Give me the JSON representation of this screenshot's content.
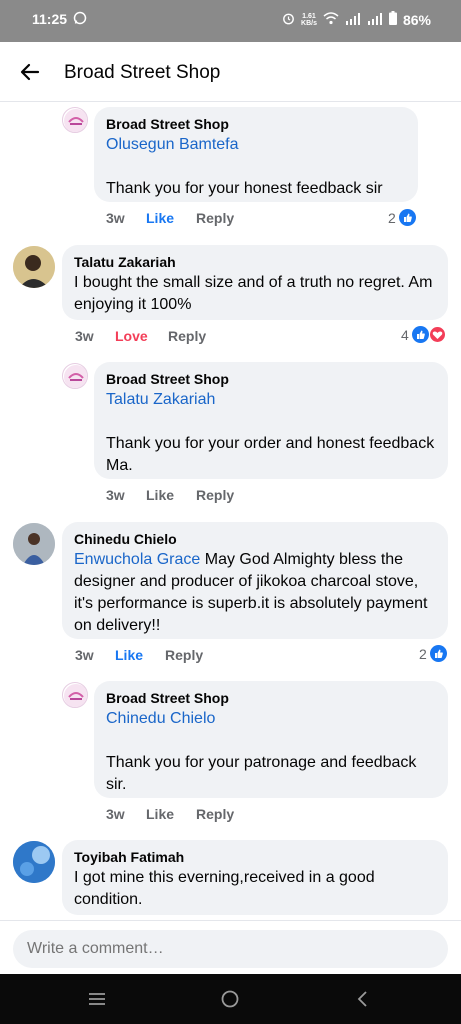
{
  "status_bar": {
    "time": "11:25",
    "speed_value": "1.61",
    "speed_unit": "KB/s",
    "battery": "86%"
  },
  "header": {
    "title": "Broad Street Shop"
  },
  "comments": [
    {
      "author": "Broad Street Shop",
      "mention": "Olusegun Bamtefa",
      "text": "Thank you for your honest feedback sir",
      "time": "3w",
      "like": "Like",
      "reply": "Reply",
      "reactions": "2"
    },
    {
      "author": "Talatu Zakariah",
      "text": "I bought the small size and of a truth no regret. Am enjoying it 100%",
      "time": "3w",
      "like": "Love",
      "reply": "Reply",
      "reactions": "4"
    },
    {
      "author": "Broad Street Shop",
      "mention": "Talatu Zakariah",
      "text": "Thank you for your order and honest feedback Ma.",
      "time": "3w",
      "like": "Like",
      "reply": "Reply"
    },
    {
      "author": "Chinedu Chielo",
      "mention": "Enwuchola Grace",
      "text": " May God Almighty bless the designer and producer of jikokoa charcoal stove, it's performance is superb.it is absolutely payment on delivery!!",
      "time": "3w",
      "like": "Like",
      "reply": "Reply",
      "reactions": "2"
    },
    {
      "author": "Broad Street Shop",
      "mention": "Chinedu Chielo",
      "text": "Thank you for your patronage and feedback sir.",
      "time": "3w",
      "like": "Like",
      "reply": "Reply"
    },
    {
      "author": "Toyibah Fatimah",
      "text": "I got mine this everning,received in a good condition."
    }
  ],
  "composer": {
    "placeholder": "Write a comment…"
  },
  "icons": {
    "back": "arrow-left-icon",
    "like": "thumbs-up-icon",
    "love": "heart-icon",
    "nav_menu": "menu-icon",
    "nav_home": "circle-home-icon",
    "nav_back": "chevron-left-icon"
  },
  "colors": {
    "link": "#1a66c9",
    "like_active": "#1877f2",
    "love": "#f33e58",
    "bubble": "#f0f2f5",
    "muted": "#65676b"
  }
}
